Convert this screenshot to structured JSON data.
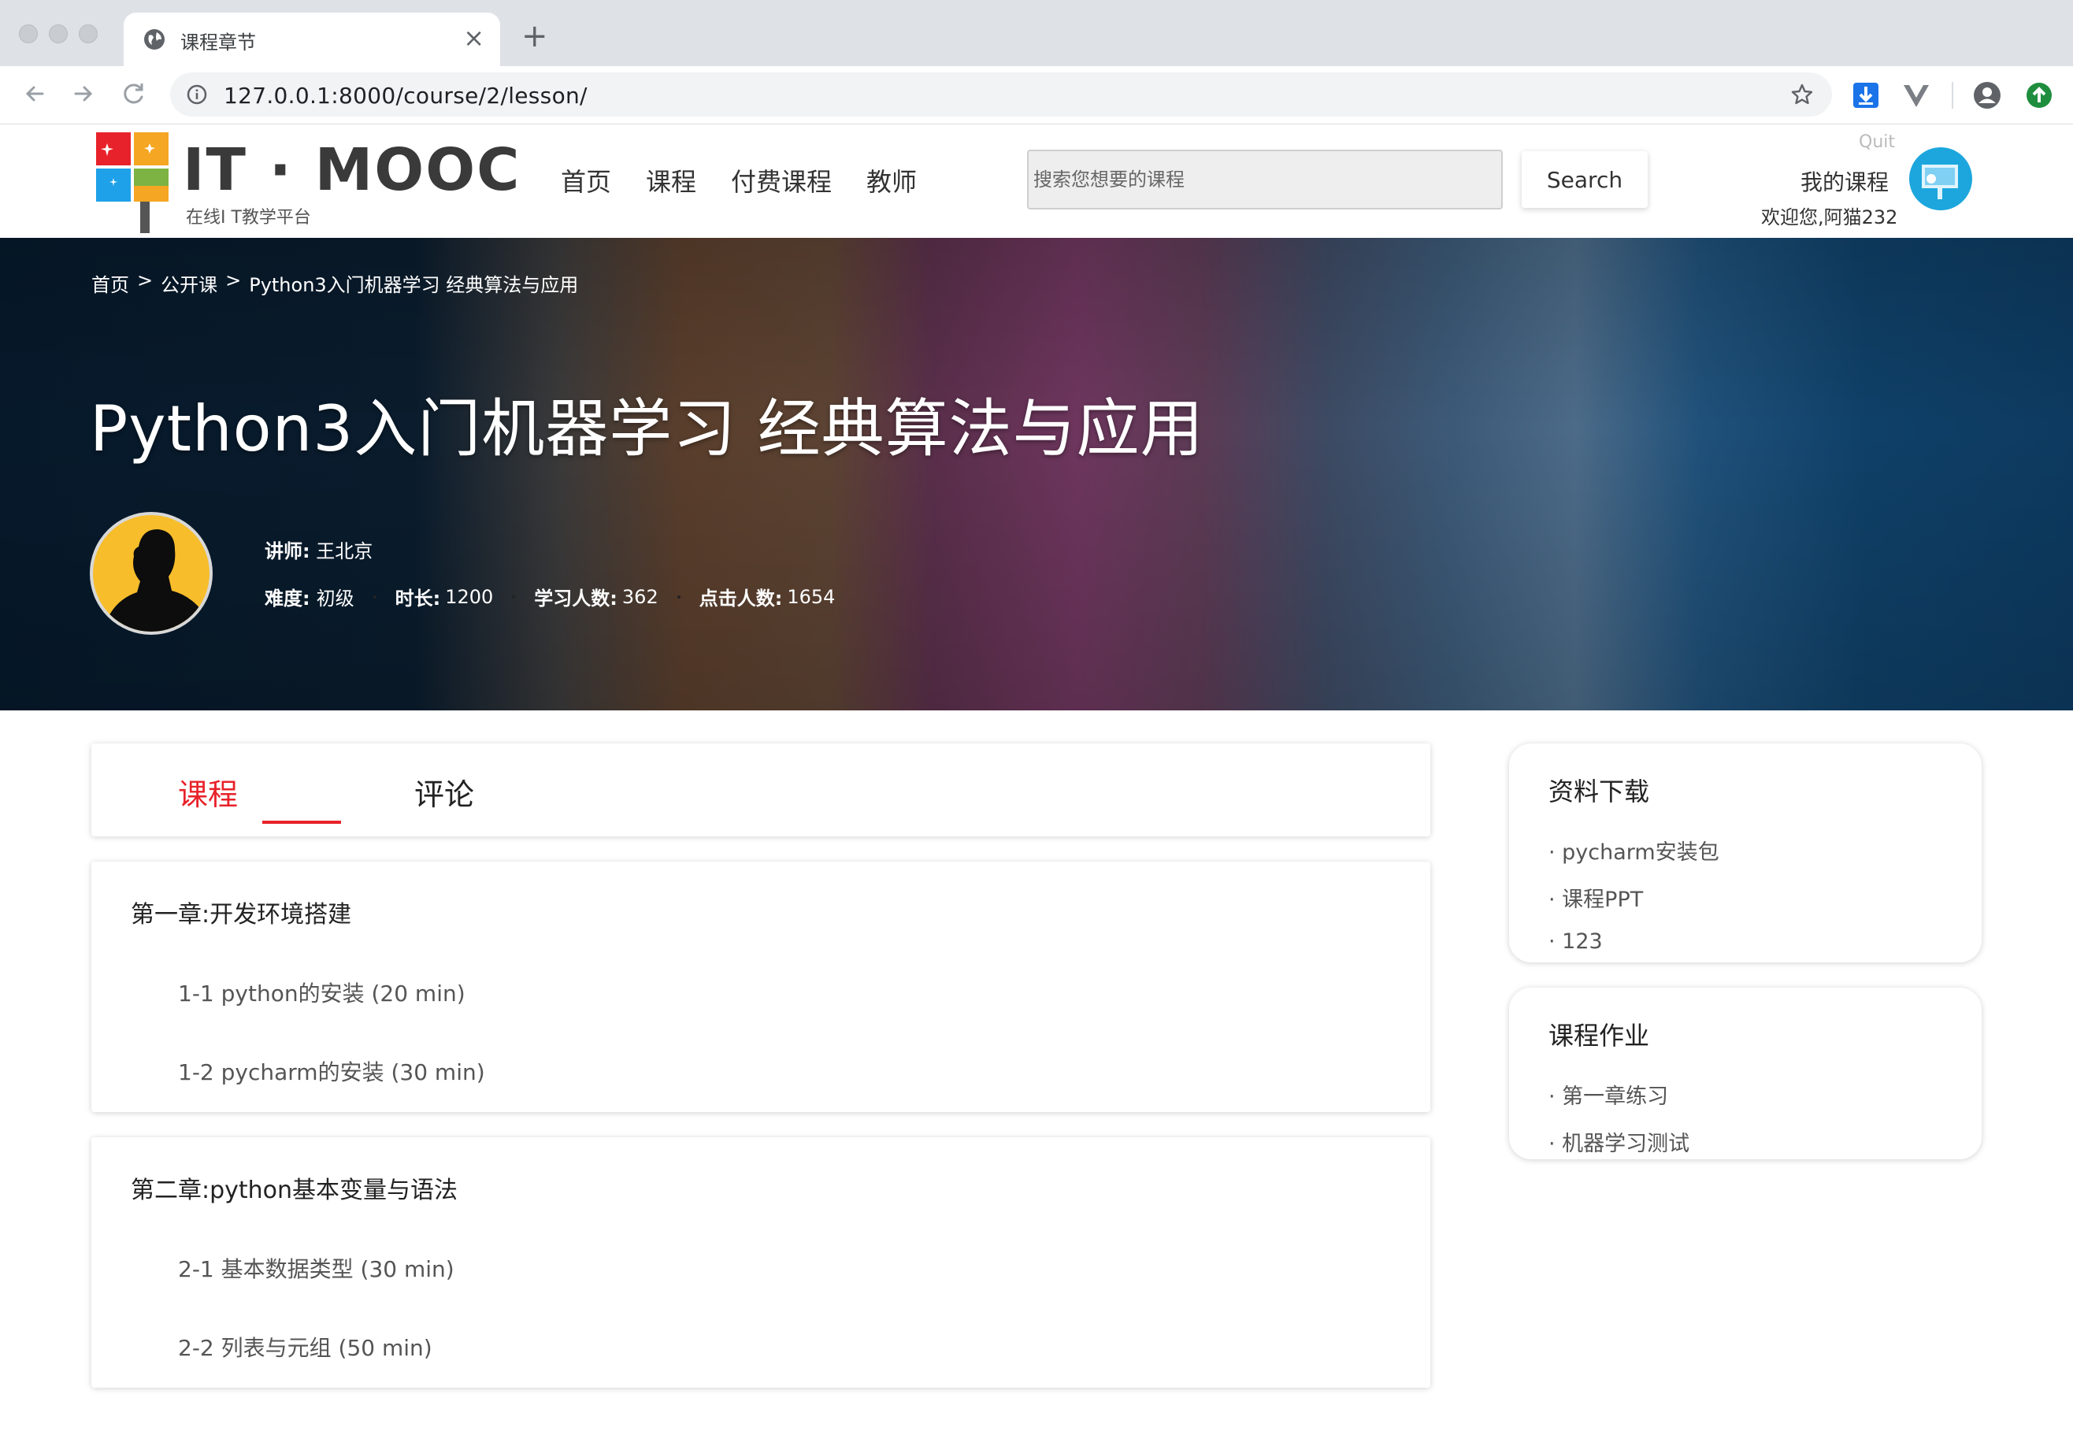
{
  "browser": {
    "tab_title": "课程章节",
    "new_tab_symbol": "+",
    "close_symbol": "×",
    "url": "127.0.0.1:8000/course/2/lesson/"
  },
  "header": {
    "logo_text": "IT · MOOC",
    "logo_sub": "在线I T教学平台",
    "nav": [
      "首页",
      "课程",
      "付费课程",
      "教师"
    ],
    "search_placeholder": "搜索您想要的课程",
    "search_button": "Search",
    "quit": "Quit",
    "my_course": "我的课程",
    "welcome": "欢迎您,阿猫232"
  },
  "banner": {
    "breadcrumb": [
      "首页",
      ">",
      "公开课",
      ">",
      "Python3入门机器学习 经典算法与应用"
    ],
    "title": "Python3入门机器学习 经典算法与应用",
    "teacher_label": "讲师:",
    "teacher_name": "王北京",
    "difficulty_label": "难度:",
    "difficulty": "初级",
    "duration_label": "时长:",
    "duration": "1200",
    "students_label": "学习人数:",
    "students": "362",
    "clicks_label": "点击人数:",
    "clicks": "1654"
  },
  "tabs": [
    "课程",
    "评论"
  ],
  "chapters": [
    {
      "title": "第一章:开发环境搭建",
      "lessons": [
        "1-1 python的安装   (20 min)",
        "1-2 pycharm的安装   (30 min)"
      ]
    },
    {
      "title": "第二章:python基本变量与语法",
      "lessons": [
        "2-1 基本数据类型   (30 min)",
        "2-2 列表与元组   (50 min)"
      ]
    }
  ],
  "sidebar": {
    "downloads_title": "资料下载",
    "downloads": [
      "· pycharm安装包",
      "· 课程PPT",
      "· 123"
    ],
    "homework_title": "课程作业",
    "homework": [
      "· 第一章练习",
      "· 机器学习测试"
    ]
  },
  "colors": {
    "accent": "#e8222a",
    "browser_chrome": "#dee1e6",
    "banner_dark": "#06192b"
  }
}
